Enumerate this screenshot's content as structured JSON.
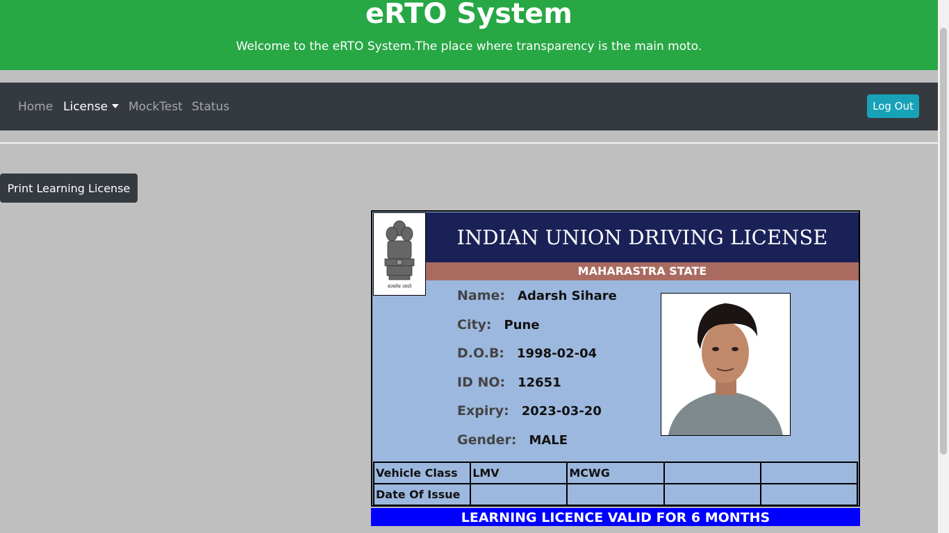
{
  "header": {
    "title": "eRTO System",
    "subtitle": "Welcome to the eRTO System.The place where transparency is the main moto."
  },
  "nav": {
    "home": "Home",
    "license": "License",
    "mocktest": "MockTest",
    "status": "Status",
    "logout": "Log Out"
  },
  "actions": {
    "print": "Print Learning License"
  },
  "license_card": {
    "banner": "INDIAN UNION DRIVING LICENSE",
    "state": "MAHARASTRA STATE",
    "emblem_text": "सत्यमेव जयते",
    "fields": [
      {
        "label": "Name:",
        "value": "Adarsh Sihare"
      },
      {
        "label": "City:",
        "value": "Pune"
      },
      {
        "label": "D.O.B:",
        "value": "1998-02-04"
      },
      {
        "label": "ID NO:",
        "value": "12651"
      },
      {
        "label": "Expiry:",
        "value": "2023-03-20"
      },
      {
        "label": "Gender:",
        "value": "MALE"
      }
    ],
    "table": {
      "row1": [
        "Vehicle Class",
        "LMV",
        "MCWG",
        "",
        ""
      ],
      "row2": [
        "Date Of Issue",
        "",
        "",
        "",
        ""
      ]
    },
    "footer": "LEARNING LICENCE VALID FOR 6 MONTHS"
  },
  "colors": {
    "header_bg": "#28a745",
    "nav_bg": "#343a40",
    "logout_bg": "#17a2b8",
    "card_bg": "#9cb8de",
    "banner_bg": "#1a2157",
    "state_bg": "#a96b60",
    "footer_bg": "#0000ff"
  }
}
